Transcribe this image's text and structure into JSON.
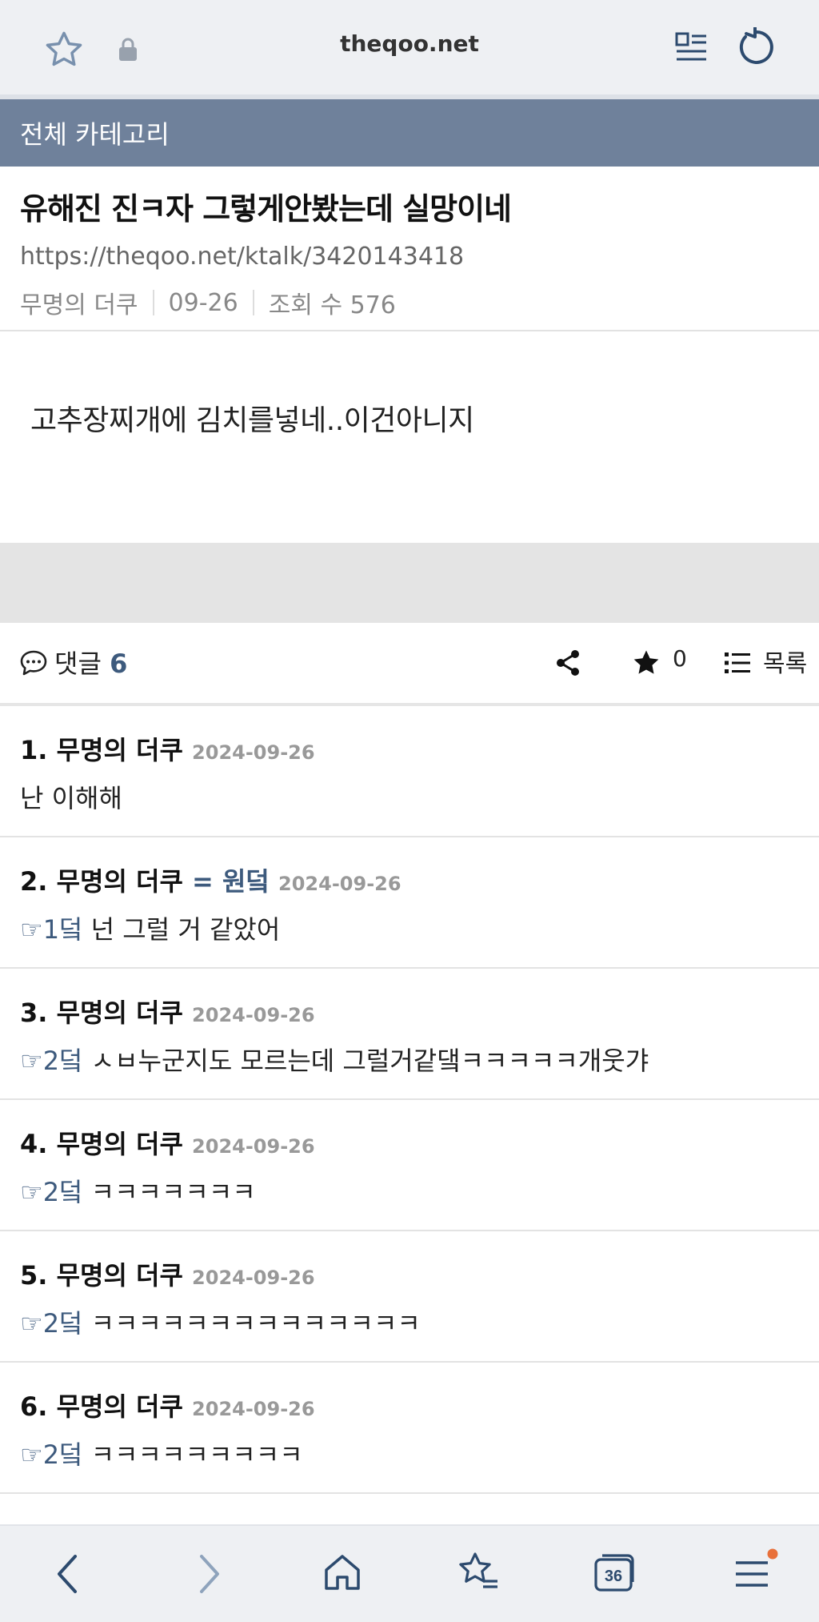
{
  "browser": {
    "url": "theqoo.net",
    "bookmark_icon": "star-outline-icon",
    "lock_icon": "lock-icon",
    "reader_icon": "reader-mode-icon",
    "reload_icon": "reload-icon"
  },
  "category": "전체 카테고리",
  "post": {
    "title": "유해진 진ㅋ자 그렇게안봤는데 실망이네",
    "url": "https://theqoo.net/ktalk/3420143418",
    "author": "무명의 더쿠",
    "date": "09-26",
    "views": "조회 수 576",
    "body": "고추장찌개에 김치를넣네..이건아니지"
  },
  "comment_bar": {
    "label": "댓글",
    "count": "6",
    "stars": "0",
    "list_label": "목록"
  },
  "comments": [
    {
      "head": "1. 무명의 더쿠",
      "op": "",
      "date": "2024-09-26",
      "reply": "",
      "text": "난 이해해"
    },
    {
      "head": "2. 무명의 더쿠",
      "op": "= 원덬",
      "date": "2024-09-26",
      "reply": "☞1덬",
      "text": " 넌 그럴 거 같았어"
    },
    {
      "head": "3. 무명의 더쿠",
      "op": "",
      "date": "2024-09-26",
      "reply": "☞2덬",
      "text": " ㅅㅂ누군지도 모르는데 그럴거같댘ㅋㅋㅋㅋㅋ개웃갸"
    },
    {
      "head": "4. 무명의 더쿠",
      "op": "",
      "date": "2024-09-26",
      "reply": "☞2덬",
      "text": " ㅋㅋㅋㅋㅋㅋㅋ"
    },
    {
      "head": "5. 무명의 더쿠",
      "op": "",
      "date": "2024-09-26",
      "reply": "☞2덬",
      "text": " ㅋㅋㅋㅋㅋㅋㅋㅋㅋㅋㅋㅋㅋㅋ"
    },
    {
      "head": "6. 무명의 더쿠",
      "op": "",
      "date": "2024-09-26",
      "reply": "☞2덬",
      "text": " ㅋㅋㅋㅋㅋㅋㅋㅋㅋ"
    }
  ],
  "bottom_nav": {
    "tabs_count": "36",
    "accent_color": "#e8703a"
  }
}
